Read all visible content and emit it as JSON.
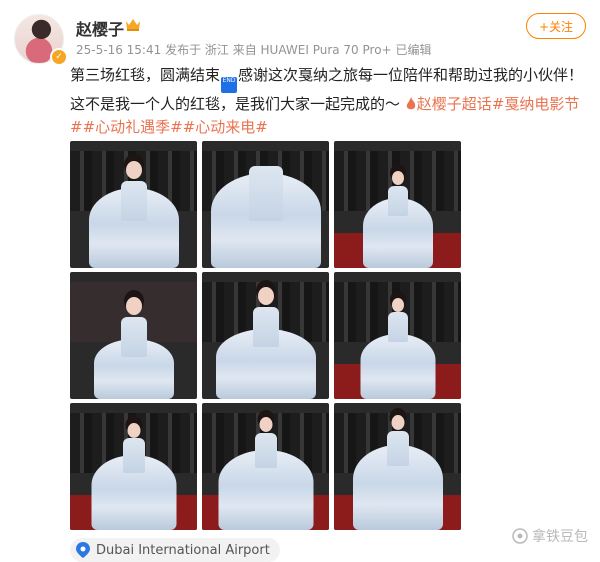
{
  "user": {
    "name": "赵樱子",
    "crown_icon": "crown-icon"
  },
  "meta": {
    "time": "25-5-16 15:41",
    "from": "发布于 浙江",
    "device": "来自 HUAWEI Pura 70 Pro+",
    "edited": "已编辑"
  },
  "follow": {
    "label": "+关注"
  },
  "post": {
    "line_a": "第三场红毯，圆满结束",
    "emoji_text": "END",
    "line_b": "感谢这次戛纳之旅每一位陪伴和帮助过我的小伙伴！这不是我一个人的红毯，是我们大家一起完成的～",
    "tags": [
      "赵樱子超话",
      "#戛纳电影节#",
      "#心动礼遇季#",
      "#心动来电#"
    ]
  },
  "photos": [
    {
      "name": "red-carpet-photo-1"
    },
    {
      "name": "red-carpet-photo-2"
    },
    {
      "name": "red-carpet-photo-3"
    },
    {
      "name": "red-carpet-photo-4"
    },
    {
      "name": "red-carpet-photo-5"
    },
    {
      "name": "red-carpet-photo-6"
    },
    {
      "name": "red-carpet-photo-7"
    },
    {
      "name": "red-carpet-photo-8"
    },
    {
      "name": "red-carpet-photo-9"
    }
  ],
  "location": {
    "label": "Dubai International Airport"
  },
  "watermark": {
    "label": "拿铁豆包"
  },
  "colors": {
    "accent": "#ff8200",
    "tag": "#eb7350",
    "location_icon": "#2b78e4"
  }
}
